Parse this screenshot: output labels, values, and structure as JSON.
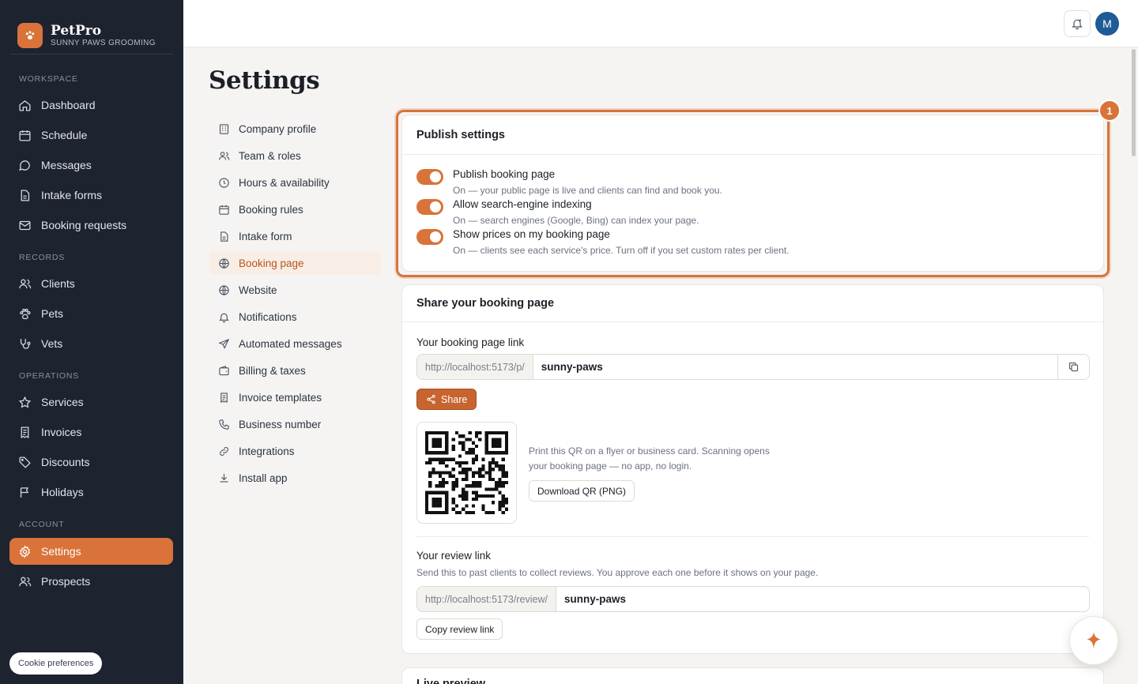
{
  "brand": {
    "name": "PetPro",
    "subtitle": "SUNNY PAWS GROOMING"
  },
  "sidebar": {
    "sections": {
      "workspace": "WORKSPACE",
      "records": "RECORDS",
      "operations": "OPERATIONS",
      "account": "ACCOUNT"
    },
    "items": {
      "dashboard": "Dashboard",
      "schedule": "Schedule",
      "messages": "Messages",
      "intake_forms": "Intake forms",
      "booking_requests": "Booking requests",
      "clients": "Clients",
      "pets": "Pets",
      "vets": "Vets",
      "services": "Services",
      "invoices": "Invoices",
      "discounts": "Discounts",
      "holidays": "Holidays",
      "settings": "Settings",
      "prospects": "Prospects"
    },
    "cookie_label": "Cookie preferences"
  },
  "header": {
    "avatar_initial": "M"
  },
  "page": {
    "title": "Settings"
  },
  "settings_nav": [
    {
      "label": "Company profile",
      "icon": "building-icon"
    },
    {
      "label": "Team & roles",
      "icon": "users-icon"
    },
    {
      "label": "Hours & availability",
      "icon": "clock-icon"
    },
    {
      "label": "Booking rules",
      "icon": "calendar-icon"
    },
    {
      "label": "Intake form",
      "icon": "file-icon"
    },
    {
      "label": "Booking page",
      "icon": "globe-icon"
    },
    {
      "label": "Website",
      "icon": "globe-icon"
    },
    {
      "label": "Notifications",
      "icon": "bell-icon"
    },
    {
      "label": "Automated messages",
      "icon": "send-icon"
    },
    {
      "label": "Billing & taxes",
      "icon": "wallet-icon"
    },
    {
      "label": "Invoice templates",
      "icon": "receipt-icon"
    },
    {
      "label": "Business number",
      "icon": "phone-icon"
    },
    {
      "label": "Integrations",
      "icon": "link-icon"
    },
    {
      "label": "Install app",
      "icon": "download-icon"
    }
  ],
  "publish": {
    "title": "Publish settings",
    "badge": "1",
    "toggles": [
      {
        "label": "Publish booking page",
        "desc": "On — your public page is live and clients can find and book you.",
        "on": true
      },
      {
        "label": "Allow search-engine indexing",
        "desc": "On — search engines (Google, Bing) can index your page.",
        "on": true
      },
      {
        "label": "Show prices on my booking page",
        "desc": "On — clients see each service's price. Turn off if you set custom rates per client.",
        "on": true
      }
    ]
  },
  "share": {
    "title": "Share your booking page",
    "link_label": "Your booking page link",
    "link_prefix": "http://localhost:5173/p/",
    "link_slug": "sunny-paws",
    "share_label": "Share",
    "qr_text": "Print this QR on a flyer or business card. Scanning opens your booking page — no app, no login.",
    "download_qr_label": "Download QR (PNG)",
    "review_label": "Your review link",
    "review_help": "Send this to past clients to collect reviews. You approve each one before it shows on your page.",
    "review_prefix": "http://localhost:5173/review/",
    "review_slug": "sunny-paws",
    "copy_review_label": "Copy review link"
  },
  "preview": {
    "title": "Live preview"
  },
  "colors": {
    "accent": "#d9733a",
    "sidebar_bg": "#1e2330"
  }
}
